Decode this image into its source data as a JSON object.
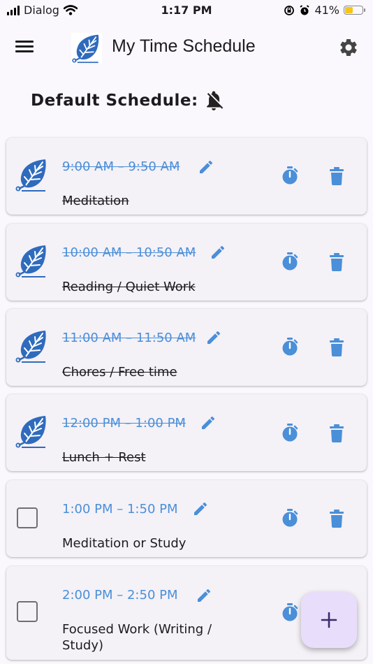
{
  "status_bar": {
    "carrier": "Dialog",
    "time": "1:17 PM",
    "battery": "41%",
    "battery_level": 0.41
  },
  "app_bar": {
    "title": "My Time Schedule"
  },
  "default_schedule": {
    "label": "Default Schedule:",
    "notifications": "off"
  },
  "items": [
    {
      "time": "9:00 AM – 9:50 AM",
      "name": "Meditation",
      "done": true
    },
    {
      "time": "10:00 AM – 10:50 AM",
      "name": "Reading / Quiet Work",
      "done": true
    },
    {
      "time": "11:00 AM – 11:50 AM",
      "name": "Chores / Free time",
      "done": true
    },
    {
      "time": "12:00 PM – 1:00 PM",
      "name": "Lunch + Rest",
      "done": true
    },
    {
      "time": "1:00 PM – 1:50 PM",
      "name": "Meditation or Study",
      "done": false
    },
    {
      "time": "2:00 PM – 2:50 PM",
      "name": "Focused Work (Writing / Study)",
      "done": false
    }
  ],
  "icons": {
    "menu": "hamburger-icon",
    "settings": "gear-icon",
    "bell": "bell-off-icon",
    "done": "leaf-icon",
    "edit": "pencil-icon",
    "timer": "timer-icon",
    "delete": "trash-icon",
    "add": "plus-icon"
  },
  "colors": {
    "accent": "#4a8fd8",
    "leaf": "#2f6bbd",
    "fab": "#e8defb",
    "background": "#fbf8fd",
    "card": "#f4f1f7"
  }
}
